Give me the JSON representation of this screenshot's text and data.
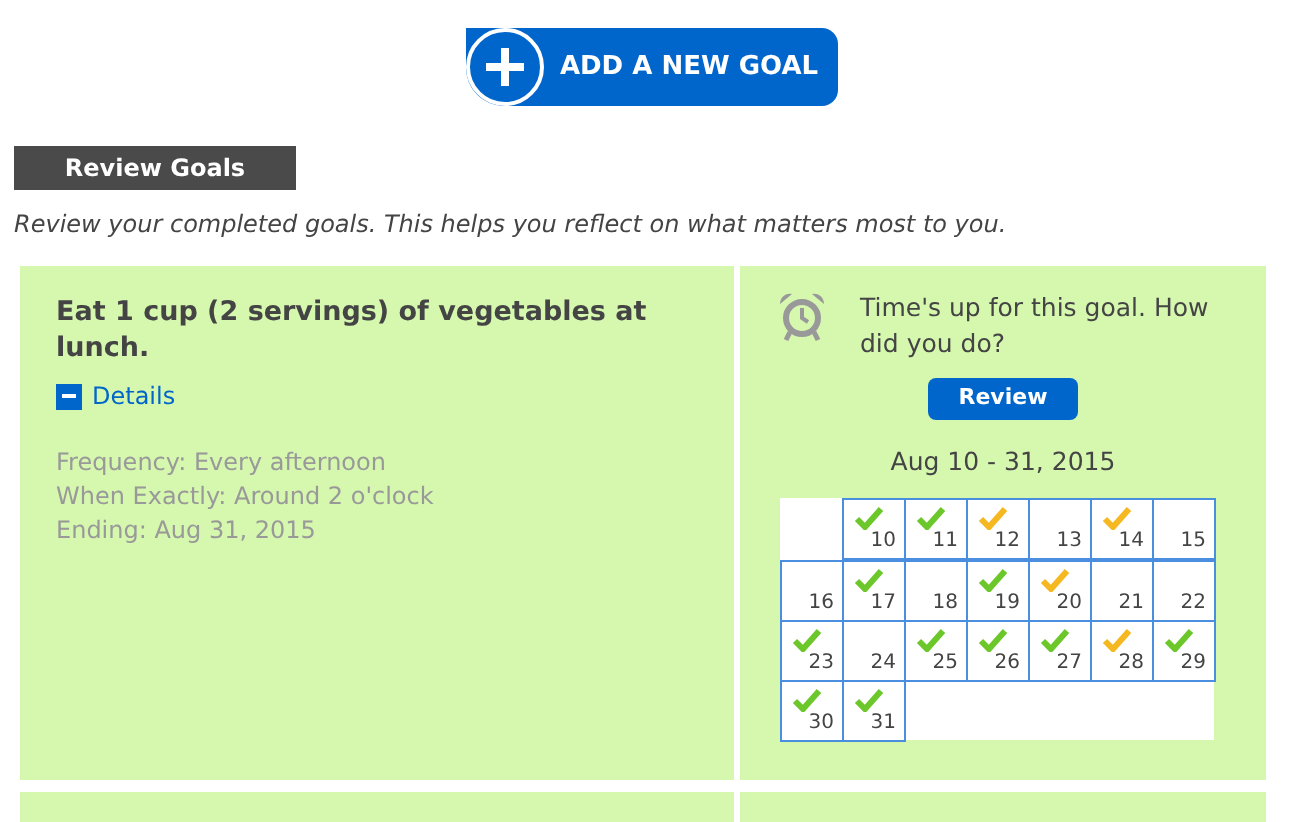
{
  "add_button": {
    "label": "ADD A NEW GOAL"
  },
  "section": {
    "title": "Review Goals",
    "intro": "Review your completed goals. This helps you reflect on what matters most to you."
  },
  "goals": [
    {
      "title": "Eat 1 cup (2 servings) of vegetables at lunch.",
      "details": {
        "label": "Details",
        "expanded": true,
        "lines": [
          "Frequency: Every afternoon",
          "When Exactly: Around 2 o'clock",
          "Ending: Aug 31, 2015"
        ]
      },
      "alert": "Time's up for this goal. How did you do?",
      "review_button": "Review",
      "range": "Aug 10 - 31, 2015",
      "days": [
        {
          "kind": "blank"
        },
        {
          "kind": "day",
          "label": "10",
          "checked": true,
          "color": "#6cc82a"
        },
        {
          "kind": "day",
          "label": "11",
          "checked": true,
          "color": "#6cc82a"
        },
        {
          "kind": "day",
          "label": "12",
          "checked": true,
          "color": "#f5b820"
        },
        {
          "kind": "day",
          "label": "13",
          "checked": false
        },
        {
          "kind": "day",
          "label": "14",
          "checked": true,
          "color": "#f5b820"
        },
        {
          "kind": "day",
          "label": "15",
          "checked": false
        },
        {
          "kind": "day",
          "label": "16",
          "checked": false
        },
        {
          "kind": "day",
          "label": "17",
          "checked": true,
          "color": "#6cc82a"
        },
        {
          "kind": "day",
          "label": "18",
          "checked": false
        },
        {
          "kind": "day",
          "label": "19",
          "checked": true,
          "color": "#6cc82a"
        },
        {
          "kind": "day",
          "label": "20",
          "checked": true,
          "color": "#f5b820"
        },
        {
          "kind": "day",
          "label": "21",
          "checked": false
        },
        {
          "kind": "day",
          "label": "22",
          "checked": false
        },
        {
          "kind": "day",
          "label": "23",
          "checked": true,
          "color": "#6cc82a"
        },
        {
          "kind": "day",
          "label": "24",
          "checked": false
        },
        {
          "kind": "day",
          "label": "25",
          "checked": true,
          "color": "#6cc82a"
        },
        {
          "kind": "day",
          "label": "26",
          "checked": true,
          "color": "#6cc82a"
        },
        {
          "kind": "day",
          "label": "27",
          "checked": true,
          "color": "#6cc82a"
        },
        {
          "kind": "day",
          "label": "28",
          "checked": true,
          "color": "#f5b820"
        },
        {
          "kind": "day",
          "label": "29",
          "checked": true,
          "color": "#6cc82a"
        },
        {
          "kind": "day",
          "label": "30",
          "checked": true,
          "color": "#6cc82a"
        },
        {
          "kind": "day",
          "label": "31",
          "checked": true,
          "color": "#6cc82a"
        }
      ]
    },
    {
      "kind": "partial-card"
    }
  ]
}
